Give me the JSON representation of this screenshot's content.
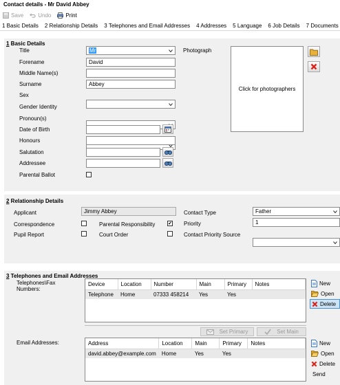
{
  "window": {
    "title": "Contact details - Mr David Abbey"
  },
  "toolbar": {
    "save": "Save",
    "undo": "Undo",
    "print": "Print"
  },
  "tabs": [
    "1 Basic Details",
    "2 Relationship Details",
    "3 Telephones and Email Addresses",
    "4 Addresses",
    "5 Language",
    "6 Job Details",
    "7 Documents"
  ],
  "basic": {
    "section_num": "1",
    "section_rest": " Basic Details",
    "title_label": "Title",
    "title_value": "Mr",
    "forename_label": "Forename",
    "forename_value": "David",
    "middle_label": "Middle Name(s)",
    "middle_value": "",
    "surname_label": "Surname",
    "surname_value": "Abbey",
    "sex_label": "Sex",
    "sex_value": "",
    "gender_label": "Gender Identity",
    "gender_value": "",
    "pronoun_label": "Pronoun(s)",
    "pronoun_value": "",
    "dob_label": "Date of Birth",
    "dob_value": "",
    "honours_label": "Honours",
    "honours_value": "",
    "salutation_label": "Salutation",
    "salutation_value": "",
    "addressee_label": "Addressee",
    "addressee_value": "",
    "ballot_label": "Parental Ballot",
    "ballot_checked": false,
    "photo_label": "Photograph",
    "photo_button": "Click for photographers"
  },
  "relationship": {
    "section_num": "2",
    "section_rest": " Relationship Details",
    "applicant_label": "Applicant",
    "applicant_value": "Jimmy Abbey",
    "correspondence_label": "Correspondence",
    "correspondence_checked": false,
    "pupil_report_label": "Pupil Report",
    "pupil_report_checked": false,
    "parental_resp_label": "Parental Responsibility",
    "parental_resp_checked": true,
    "court_order_label": "Court Order",
    "court_order_checked": false,
    "contact_type_label": "Contact Type",
    "contact_type_value": "Father",
    "priority_label": "Priority",
    "priority_value": "1",
    "priority_source_label": "Contact Priority Source",
    "priority_source_value": ""
  },
  "telecom": {
    "section_num": "3",
    "section_rest": " Telephones and Email Addresses",
    "phones_label_1": "Telephones\\Fax",
    "phones_label_2": "Numbers:",
    "phone_columns": [
      "Device",
      "Location",
      "Number",
      "Main",
      "Primary",
      "Notes"
    ],
    "phone_rows": [
      [
        "Telephone",
        "Home",
        "07333 458214",
        "Yes",
        "Yes",
        ""
      ]
    ],
    "phone_actions": {
      "new": "New",
      "open": "Open",
      "delete": "Delete"
    },
    "set_primary": "Set Primary",
    "set_main": "Set Main",
    "email_label": "Email Addresses:",
    "email_columns": [
      "Address",
      "Location",
      "Main",
      "Primary",
      "Notes"
    ],
    "email_rows": [
      [
        "david.abbey@example.com",
        "Home",
        "Yes",
        "Yes",
        ""
      ]
    ],
    "email_actions": {
      "new": "New",
      "open": "Open",
      "delete": "Delete",
      "send": "Send"
    }
  },
  "colors": {
    "panel": "#f0f0f0",
    "selected_action": "#cce4f7",
    "delete_red": "#d9241c",
    "new_blue": "#3a78c8",
    "folder_yellow": "#e8b23a"
  }
}
